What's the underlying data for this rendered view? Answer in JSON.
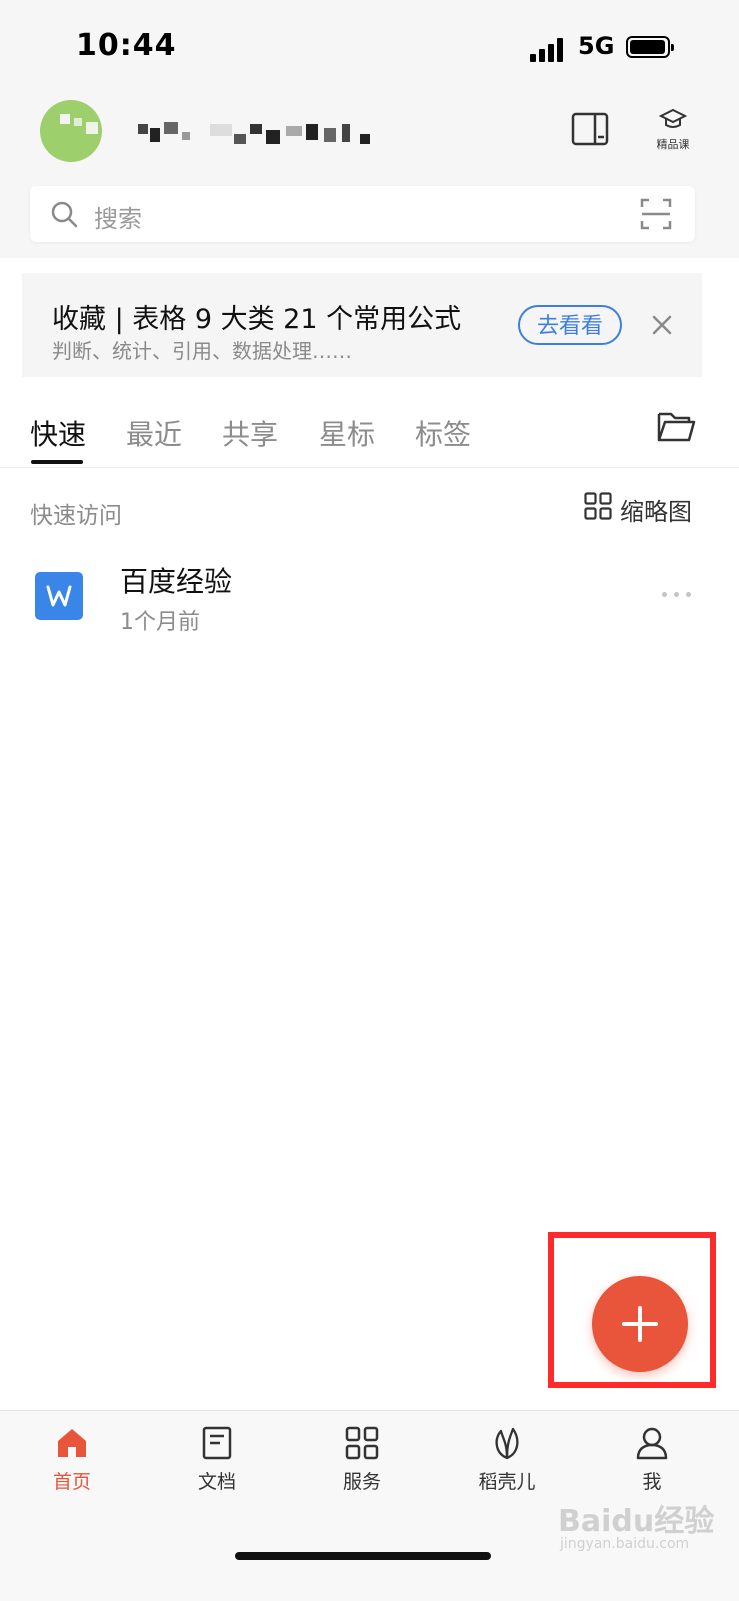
{
  "status_bar": {
    "time": "10:44",
    "network": "5G"
  },
  "header": {
    "course_label": "精品课"
  },
  "search": {
    "placeholder": "搜索"
  },
  "banner": {
    "title": "收藏 | 表格 9 大类 21 个常用公式",
    "subtitle": "判断、统计、引用、数据处理……",
    "action_label": "去看看"
  },
  "tabs": [
    {
      "label": "快速",
      "active": true
    },
    {
      "label": "最近",
      "active": false
    },
    {
      "label": "共享",
      "active": false
    },
    {
      "label": "星标",
      "active": false
    },
    {
      "label": "标签",
      "active": false
    }
  ],
  "quick_access": {
    "section_label": "快速访问",
    "view_toggle_label": "缩略图",
    "files": [
      {
        "name": "百度经验",
        "time": "1个月前",
        "icon": "word-doc-icon"
      }
    ]
  },
  "bottom_nav": [
    {
      "label": "首页",
      "icon": "home-icon",
      "active": true
    },
    {
      "label": "文档",
      "icon": "document-icon",
      "active": false
    },
    {
      "label": "服务",
      "icon": "grid-icon",
      "active": false
    },
    {
      "label": "稻壳儿",
      "icon": "leaf-icon",
      "active": false
    },
    {
      "label": "我",
      "icon": "person-icon",
      "active": false
    }
  ],
  "colors": {
    "accent": "#e8553a",
    "link_blue": "#3d7ee0",
    "highlight_red": "#ff2a2a",
    "avatar_green": "#9dcf6c"
  },
  "watermark": {
    "text": "Baidu经验",
    "sub": "jingyan.baidu.com"
  }
}
